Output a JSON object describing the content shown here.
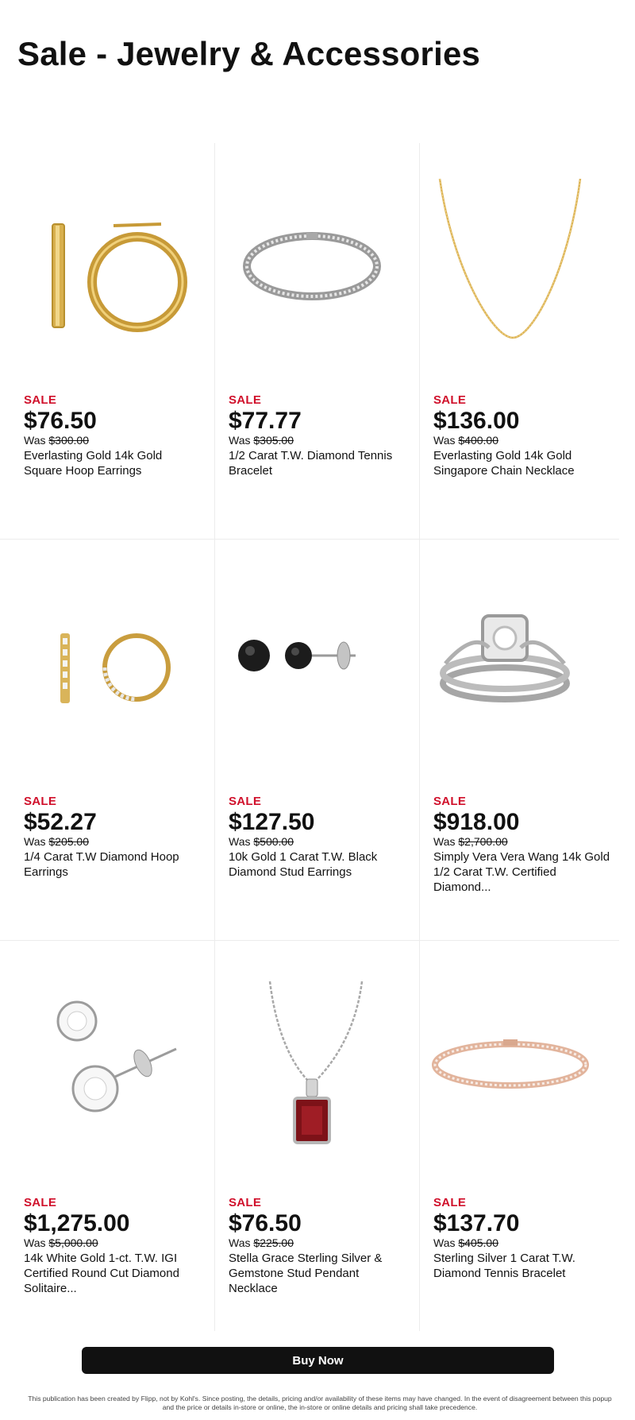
{
  "page": {
    "title": "Sale - Jewelry & Accessories"
  },
  "products": [
    {
      "badge": "SALE",
      "price": "$76.50",
      "was_prefix": "Was",
      "was_price": "$300.00",
      "name": "Everlasting Gold 14k Gold Square Hoop Earrings",
      "image_icon": "gold-hoop-earrings-icon"
    },
    {
      "badge": "SALE",
      "price": "$77.77",
      "was_prefix": "Was",
      "was_price": "$305.00",
      "name": "1/2 Carat T.W. Diamond Tennis Bracelet",
      "image_icon": "diamond-tennis-bracelet-icon"
    },
    {
      "badge": "SALE",
      "price": "$136.00",
      "was_prefix": "Was",
      "was_price": "$400.00",
      "name": "Everlasting Gold 14k Gold Singapore Chain Necklace",
      "image_icon": "gold-chain-necklace-icon"
    },
    {
      "badge": "SALE",
      "price": "$52.27",
      "was_prefix": "Was",
      "was_price": "$205.00",
      "name": "1/4 Carat T.W Diamond Hoop Earrings",
      "image_icon": "diamond-hoop-earrings-icon"
    },
    {
      "badge": "SALE",
      "price": "$127.50",
      "was_prefix": "Was",
      "was_price": "$500.00",
      "name": "10k Gold 1 Carat T.W. Black Diamond Stud Earrings",
      "image_icon": "black-diamond-stud-earrings-icon"
    },
    {
      "badge": "SALE",
      "price": "$918.00",
      "was_prefix": "Was",
      "was_price": "$2,700.00",
      "name": "Simply Vera Vera Wang 14k Gold 1/2 Carat T.W. Certified Diamond...",
      "image_icon": "engagement-ring-set-icon"
    },
    {
      "badge": "SALE",
      "price": "$1,275.00",
      "was_prefix": "Was",
      "was_price": "$5,000.00",
      "name": "14k White Gold 1-ct. T.W. IGI Certified Round Cut Diamond Solitaire...",
      "image_icon": "diamond-solitaire-earrings-icon"
    },
    {
      "badge": "SALE",
      "price": "$76.50",
      "was_prefix": "Was",
      "was_price": "$225.00",
      "name": "Stella Grace Sterling Silver & Gemstone Stud Pendant Necklace",
      "image_icon": "gemstone-pendant-necklace-icon"
    },
    {
      "badge": "SALE",
      "price": "$137.70",
      "was_prefix": "Was",
      "was_price": "$405.00",
      "name": "Sterling Silver 1 Carat T.W. Diamond Tennis Bracelet",
      "image_icon": "rose-gold-tennis-bracelet-icon"
    }
  ],
  "cta": {
    "label": "Buy Now"
  },
  "footer": {
    "disclaimer": "This publication has been created by Flipp, not by Kohl's. Since posting, the details, pricing and/or availability of these items may have changed. In the event of disagreement between this popup and the price or details in-store or online, the in-store or online details and pricing shall take precedence."
  },
  "colors": {
    "sale_red": "#d0102b",
    "button_bg": "#111111",
    "divider": "#ececec"
  }
}
